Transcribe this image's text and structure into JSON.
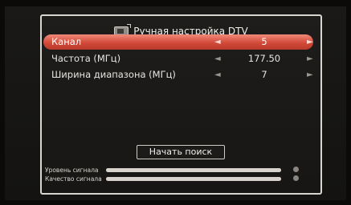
{
  "title": "Ручная настройка DTV",
  "icons": {
    "title_icon": "tv-icon"
  },
  "colors": {
    "highlight": "#d24a39"
  },
  "rows": [
    {
      "label": "Канал",
      "value": "5"
    },
    {
      "label": "Частота (МГц)",
      "value": "177.50"
    },
    {
      "label": "Ширина диапазона (МГц)",
      "value": "7"
    }
  ],
  "arrow_left": "◄",
  "arrow_right": "►",
  "search_button": "Начать поиск",
  "signal": {
    "level_label": "Уровень сигнала",
    "quality_label": "Качество сигнала",
    "level_value": 1.0,
    "quality_value": 1.0
  }
}
